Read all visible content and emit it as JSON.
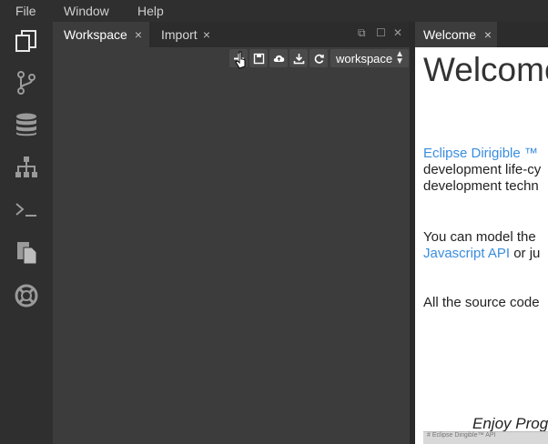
{
  "menu": {
    "file": "File",
    "window": "Window",
    "help": "Help"
  },
  "activity_icons": [
    "workspace-icon",
    "git-branch-icon",
    "database-icon",
    "hierarchy-icon",
    "terminal-icon",
    "documents-icon",
    "help-lifebuoy-icon"
  ],
  "left_tabs": [
    {
      "label": "Workspace",
      "close": "×"
    },
    {
      "label": "Import",
      "close": "×"
    }
  ],
  "window_controls": {
    "restore": "⧉",
    "maximize": "☐",
    "close": "✕"
  },
  "toolbar": {
    "icons": [
      "new-icon",
      "save-icon",
      "upload-icon",
      "download-icon",
      "refresh-icon"
    ],
    "workspace_select": "workspace"
  },
  "right_tab": {
    "label": "Welcome",
    "close": "×"
  },
  "welcome": {
    "title": "Welcome",
    "p1_link": "Eclipse Dirigible ™",
    "p1_line2": "development life-cy",
    "p1_line3": "development techn",
    "p2_line1": "You can model the",
    "p2_link": "Javascript API",
    "p2_rest": " or ju",
    "p3": "All the source code",
    "enjoy": "Enjoy Prog",
    "thumb_caption": "# Eclipse Dirigible™ API"
  },
  "colors": {
    "link": "#3a8de0",
    "background": "#3c3c3c",
    "sidebar": "#2f2f2f"
  }
}
